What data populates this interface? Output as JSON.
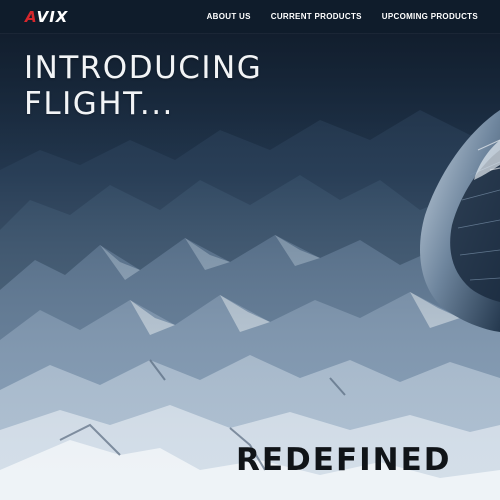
{
  "brand": {
    "logo_first": "A",
    "logo_rest": "VIX",
    "accent_color": "#d6262c"
  },
  "nav": {
    "items": [
      {
        "label": "ABOUT US"
      },
      {
        "label": "CURRENT PRODUCTS"
      },
      {
        "label": "UPCOMING PRODUCTS"
      }
    ]
  },
  "hero": {
    "headline_line1": "INTRODUCING",
    "headline_line2": "FLIGHT...",
    "tagline": "REDEFINED"
  }
}
